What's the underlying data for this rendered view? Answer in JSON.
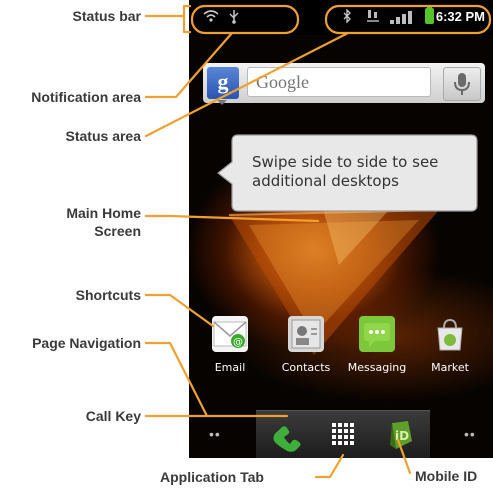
{
  "callouts": {
    "status_bar": "Status bar",
    "notification_area": "Notification area",
    "status_area": "Status area",
    "main_home_line1": "Main Home",
    "main_home_line2": "Screen",
    "shortcuts": "Shortcuts",
    "page_navigation": "Page Navigation",
    "call_key": "Call Key",
    "application_tab": "Application Tab",
    "mobile_id": "Mobile ID"
  },
  "status_bar": {
    "time": "6:32 PM",
    "icons": [
      "wifi-icon",
      "usb-icon",
      "bluetooth-icon",
      "data-icon",
      "signal-icon",
      "battery-icon"
    ]
  },
  "search": {
    "placeholder": "Google",
    "logo": "g"
  },
  "tooltip": {
    "text": "Swipe side to side to see additional desktops"
  },
  "shortcuts": [
    {
      "label": "Email",
      "icon": "email-icon"
    },
    {
      "label": "Contacts",
      "icon": "contacts-icon"
    },
    {
      "label": "Messaging",
      "icon": "messaging-icon"
    },
    {
      "label": "Market",
      "icon": "market-icon"
    }
  ],
  "page_navigation": {
    "left": "••",
    "right": "••"
  },
  "dock": {
    "icons": [
      "phone-icon",
      "app-grid-icon",
      "mobile-id-icon"
    ]
  },
  "colors": {
    "callout_line": "#f0a030",
    "callout_text": "#3a3a3a",
    "battery": "#55c32a"
  }
}
